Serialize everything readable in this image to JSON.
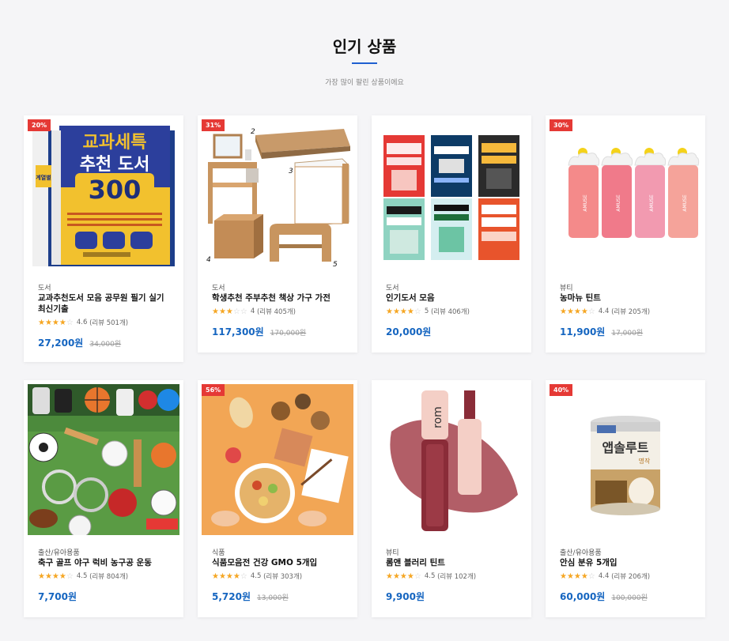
{
  "section": {
    "title": "인기 상품",
    "subtitle": "가장 많이 팔린 상품이에요"
  },
  "products": [
    {
      "badge": "20%",
      "category": "도서",
      "name": "교과추천도서 모음 공무원 필기 실기 최신기출",
      "stars": 4,
      "rating": "4.6",
      "reviews": "(리뷰 501개)",
      "price": "27,200원",
      "original_price": "34,000원",
      "image": "textbook-cover-image"
    },
    {
      "badge": "31%",
      "category": "도서",
      "name": "학생추천 주부추천 책상 가구 가전",
      "stars": 3,
      "rating": "4",
      "reviews": "(리뷰 405개)",
      "price": "117,300원",
      "original_price": "170,000원",
      "image": "furniture-set-image"
    },
    {
      "badge": "",
      "category": "도서",
      "name": "인기도서 모음",
      "stars": 4,
      "rating": "5",
      "reviews": "(리뷰 406개)",
      "price": "20,000원",
      "original_price": "",
      "image": "book-collection-image"
    },
    {
      "badge": "30%",
      "category": "뷰티",
      "name": "농마뉴 틴트",
      "stars": 4,
      "rating": "4.4",
      "reviews": "(리뷰 205개)",
      "price": "11,900원",
      "original_price": "17,000원",
      "image": "tint-bottles-image"
    },
    {
      "badge": "",
      "category": "출산/유아용품",
      "name": "축구 골프 야구 럭비 농구공 운동",
      "stars": 4,
      "rating": "4.5",
      "reviews": "(리뷰 804개)",
      "price": "7,700원",
      "original_price": "",
      "image": "sports-balls-image"
    },
    {
      "badge": "56%",
      "category": "식품",
      "name": "식품모음전 건강 GMO 5개입",
      "stars": 4,
      "rating": "4.5",
      "reviews": "(리뷰 303개)",
      "price": "5,720원",
      "original_price": "13,000원",
      "image": "food-spread-image"
    },
    {
      "badge": "",
      "category": "뷰티",
      "name": "롬앤 블러리 틴트",
      "stars": 4,
      "rating": "4.5",
      "reviews": "(리뷰 102개)",
      "price": "9,900원",
      "original_price": "",
      "image": "lip-tint-image"
    },
    {
      "badge": "40%",
      "category": "출산/유아용품",
      "name": "안심 분유 5개입",
      "stars": 4,
      "rating": "4.4",
      "reviews": "(리뷰 206개)",
      "price": "60,000원",
      "original_price": "100,000원",
      "image": "formula-can-image"
    }
  ],
  "image_text": {
    "book_title_1": "교과세특",
    "book_title_2": "추천 도서",
    "book_title_3": "300",
    "book_side": "계열별",
    "furniture_labels": [
      "2",
      "3",
      "4",
      "5"
    ],
    "tint_brand": "AMUSE",
    "formula_name": "앱솔루트",
    "formula_sub": "명작",
    "romand_logo": "rom"
  },
  "colors": {
    "accent": "#1f5fd0",
    "price": "#1565c0",
    "badge": "#e53935",
    "star": "#f5a623"
  }
}
